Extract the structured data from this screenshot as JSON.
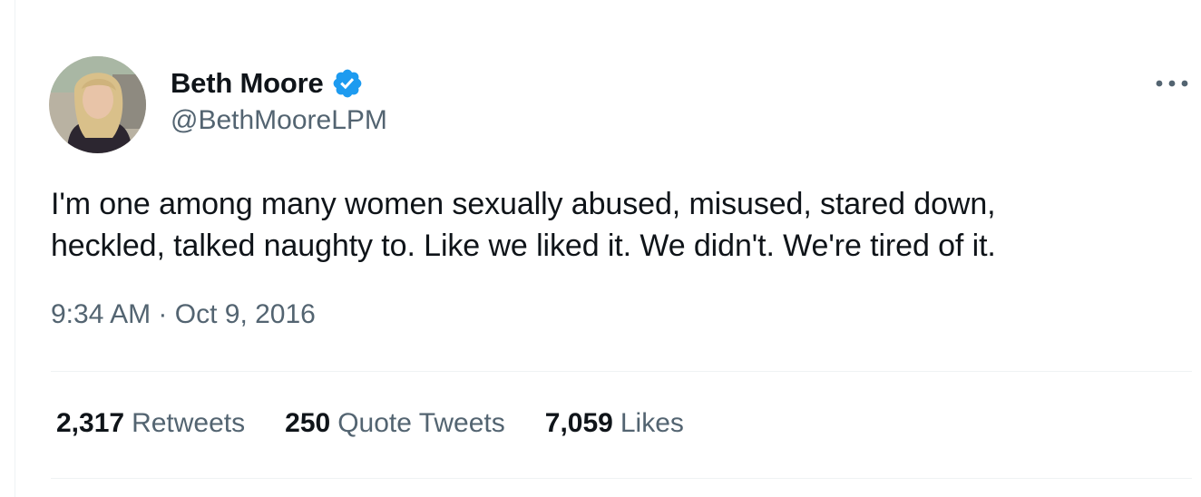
{
  "author": {
    "display_name": "Beth Moore",
    "handle": "@BethMooreLPM",
    "verified": true
  },
  "tweet": {
    "text_line_1": "I'm one among many women sexually abused, misused, stared down,",
    "text_line_2": "heckled, talked naughty to. Like we liked it. We didn't. We're tired of it.",
    "time": "9:34 AM",
    "separator": " · ",
    "date": "Oct 9, 2016"
  },
  "stats": {
    "retweets": {
      "count": "2,317",
      "label": "Retweets"
    },
    "quote_tweets": {
      "count": "250",
      "label": "Quote Tweets"
    },
    "likes": {
      "count": "7,059",
      "label": "Likes"
    }
  },
  "icons": {
    "verified": "verified-badge-icon",
    "more": "more-options-icon"
  },
  "colors": {
    "text_primary": "#0f1419",
    "text_secondary": "#536471",
    "verified_blue": "#1d9bf0",
    "divider": "#eff3f4"
  }
}
